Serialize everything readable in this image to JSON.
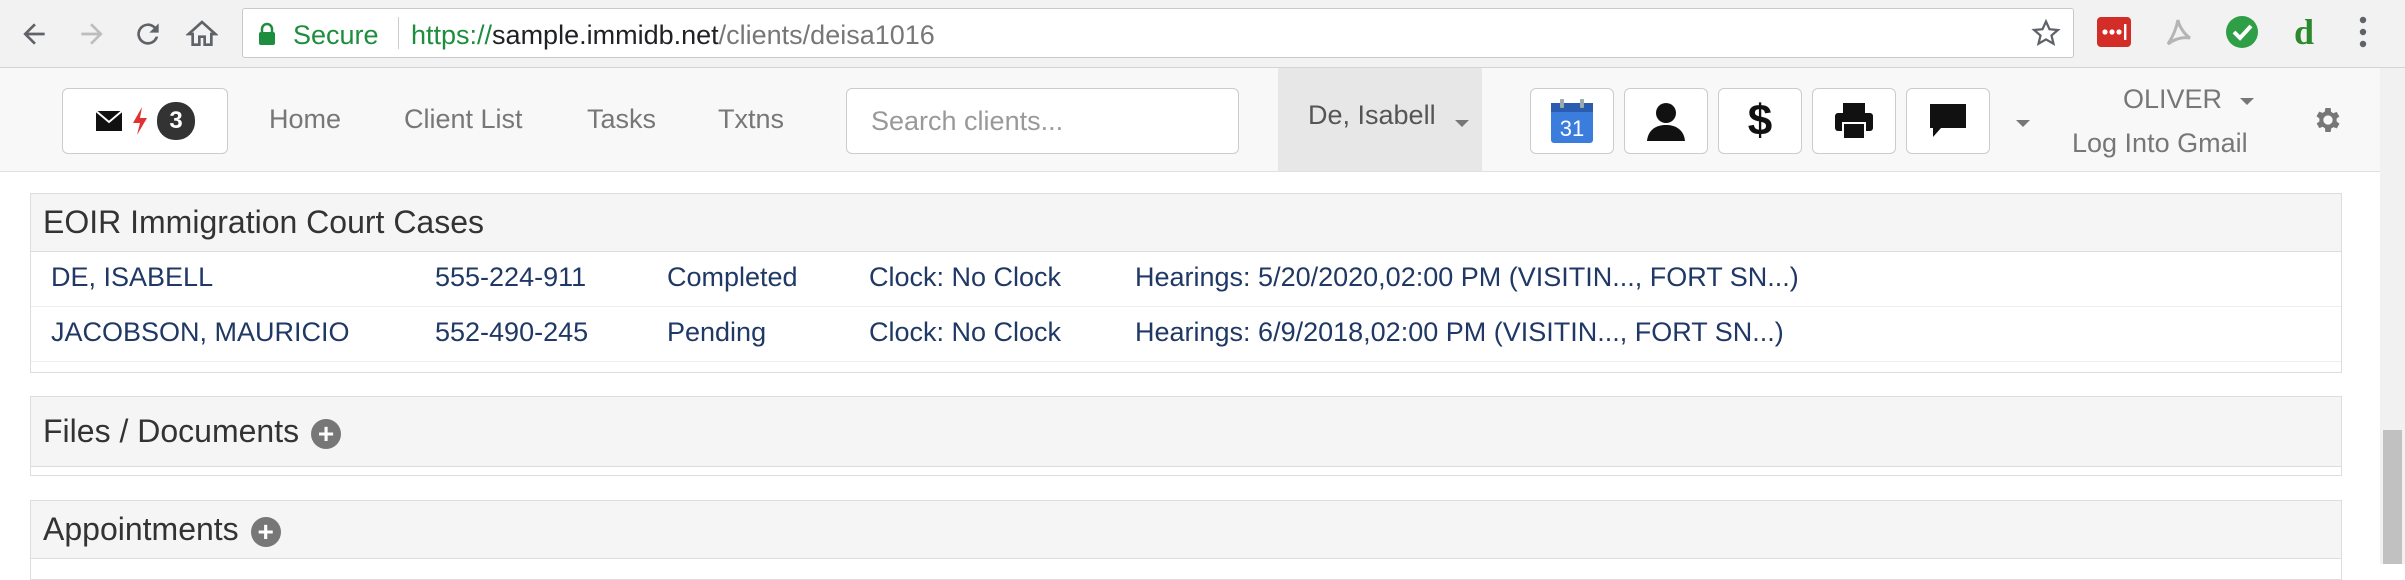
{
  "browser": {
    "secure_label": "Secure",
    "url_scheme": "https://",
    "url_host": "sample.immidb.net",
    "url_path": "/clients/deisa1016"
  },
  "navbar": {
    "notification_count": "3",
    "links": [
      "Home",
      "Client List",
      "Tasks",
      "Txtns"
    ],
    "search_placeholder": "Search clients...",
    "current_client": "De, Isabell",
    "calendar_day": "31",
    "dollar_symbol": "$",
    "user_name": "OLIVER",
    "gmail_link": "Log Into Gmail"
  },
  "eoir": {
    "title": "EOIR Immigration Court Cases",
    "rows": [
      {
        "name": "DE, ISABELL",
        "a_number": "555-224-911",
        "status": "Completed",
        "clock": "Clock: No Clock",
        "hearings": "Hearings: 5/20/2020,02:00 PM (VISITIN..., FORT SN...)"
      },
      {
        "name": "JACOBSON, MAURICIO",
        "a_number": "552-490-245",
        "status": "Pending",
        "clock": "Clock: No Clock",
        "hearings": "Hearings: 6/9/2018,02:00 PM (VISITIN..., FORT SN...)"
      }
    ]
  },
  "files": {
    "title": "Files / Documents"
  },
  "appointments": {
    "title": "Appointments"
  },
  "colors": {
    "secure_green": "#1e8e3e",
    "case_text": "#1f3865",
    "lastpass_red": "#d32d27",
    "check_green": "#2e9e47",
    "d_green": "#2b8a2b"
  }
}
